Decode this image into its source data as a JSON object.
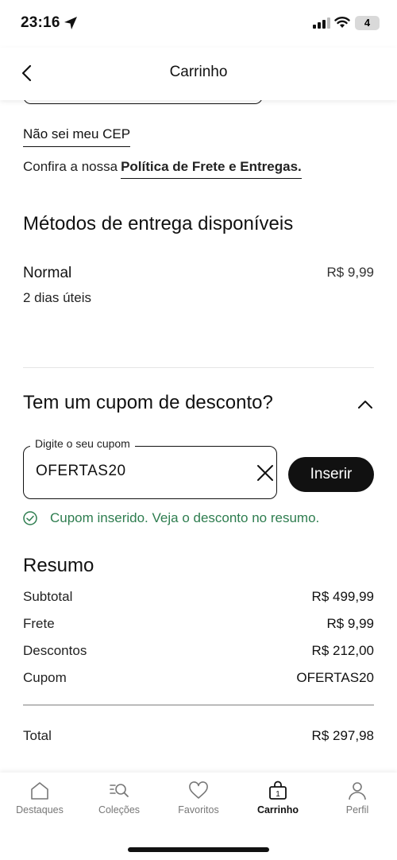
{
  "status": {
    "time": "23:16",
    "battery": "4"
  },
  "header": {
    "title": "Carrinho"
  },
  "shipping": {
    "cep_unknown_link": "Não sei meu CEP",
    "policy_prefix": "Confira a nossa",
    "policy_link": "Política de Frete e Entregas.",
    "methods_title": "Métodos de entrega disponíveis",
    "method": {
      "name": "Normal",
      "days": "2 dias úteis",
      "price": "R$ 9,99"
    }
  },
  "coupon": {
    "title": "Tem um cupom de desconto?",
    "field_label": "Digite o seu cupom",
    "field_value": "OFERTAS20",
    "insert_label": "Inserir",
    "success_message": "Cupom inserido. Veja o desconto no resumo.",
    "success_color": "#2e7d4f"
  },
  "summary": {
    "title": "Resumo",
    "rows": [
      {
        "label": "Subtotal",
        "value": "R$ 499,99"
      },
      {
        "label": "Frete",
        "value": "R$ 9,99"
      },
      {
        "label": "Descontos",
        "value": "R$ 212,00"
      },
      {
        "label": "Cupom",
        "value": "OFERTAS20"
      }
    ],
    "total_label": "Total",
    "total_value": "R$ 297,98"
  },
  "tabbar": {
    "items": [
      {
        "label": "Destaques",
        "icon": "home-icon"
      },
      {
        "label": "Coleções",
        "icon": "collections-search-icon"
      },
      {
        "label": "Favoritos",
        "icon": "heart-icon"
      },
      {
        "label": "Carrinho",
        "icon": "cart-bag-icon",
        "badge": "1",
        "active": true
      },
      {
        "label": "Perfil",
        "icon": "profile-icon"
      }
    ]
  }
}
